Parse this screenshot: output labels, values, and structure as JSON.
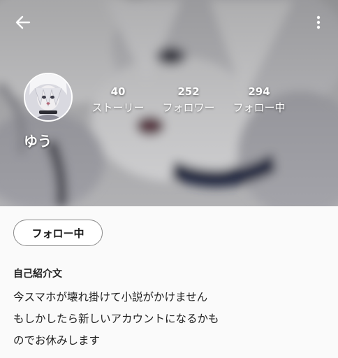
{
  "header": {
    "back_icon": "arrow-left-icon",
    "more_icon": "more-vertical-icon"
  },
  "profile": {
    "username": "ゆう",
    "stats": [
      {
        "value": "40",
        "label": "ストーリー"
      },
      {
        "value": "252",
        "label": "フォロワー"
      },
      {
        "value": "294",
        "label": "フォロー中"
      }
    ]
  },
  "actions": {
    "follow_label": "フォロー中"
  },
  "bio": {
    "title": "自己紹介文",
    "lines": [
      "今スマホが壊れ掛けて小説がかけません",
      "もしかしたら新しいアカウントになるかも",
      "のでお休みします"
    ]
  }
}
